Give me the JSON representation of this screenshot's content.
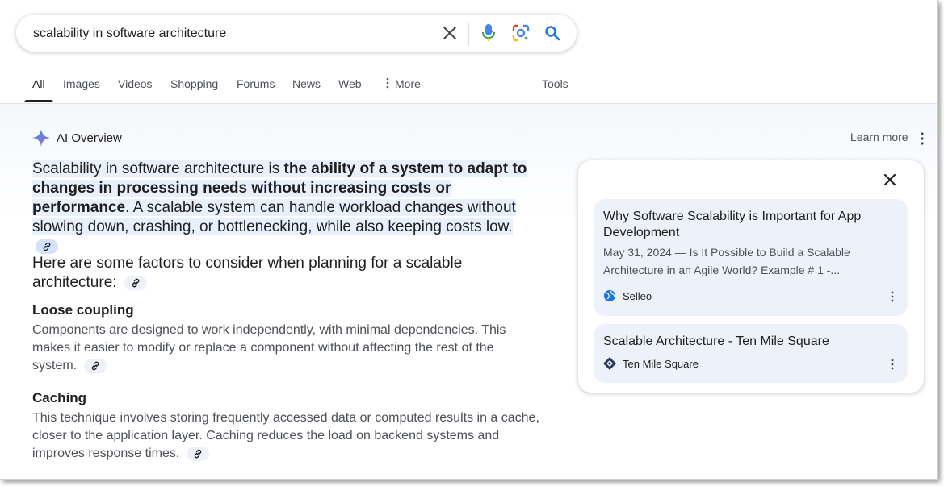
{
  "search": {
    "query": "scalability in software architecture",
    "clear_icon": "close-icon",
    "voice_icon": "mic-icon",
    "lens_icon": "lens-icon",
    "search_icon": "search-icon"
  },
  "tabs": [
    {
      "label": "All",
      "active": true
    },
    {
      "label": "Images"
    },
    {
      "label": "Videos"
    },
    {
      "label": "Shopping"
    },
    {
      "label": "Forums"
    },
    {
      "label": "News"
    },
    {
      "label": "Web"
    },
    {
      "label": "More"
    },
    {
      "label": "Tools"
    }
  ],
  "ai_overview": {
    "title": "AI Overview",
    "learn_more": "Learn more",
    "lead_part1": "Scalability in software architecture is ",
    "lead_bold": "the ability of a system to adapt to changes in processing needs without increasing costs or performance",
    "lead_part2": ". A scalable system can handle workload changes without slowing down, crashing, or bottlenecking, while also keeping costs low.",
    "factors_intro": "Here are some factors to consider when planning for a scalable architecture:",
    "sections": [
      {
        "heading": "Loose coupling",
        "body": "Components are designed to work independently, with minimal dependencies. This makes it easier to modify or replace a component without affecting the rest of the system."
      },
      {
        "heading": "Caching",
        "body": "This technique involves storing frequently accessed data or computed results in a cache, closer to the application layer. Caching reduces the load on backend systems and improves response times."
      }
    ]
  },
  "sources": [
    {
      "title": "Why Software Scalability is Important for App Development",
      "snippet": "May 31, 2024 — Is It Possible to Build a Scalable Architecture in an Agile World? Example # 1 -...",
      "site": "Selleo",
      "favicon": "globe-icon"
    },
    {
      "title": "Scalable Architecture - Ten Mile Square",
      "site": "Ten Mile Square",
      "favicon": "diamond-logo-icon"
    }
  ],
  "colors": {
    "accent_blue": "#1a73e8",
    "highlight": "#e8f0fe",
    "card_bg": "#edf2fa"
  }
}
